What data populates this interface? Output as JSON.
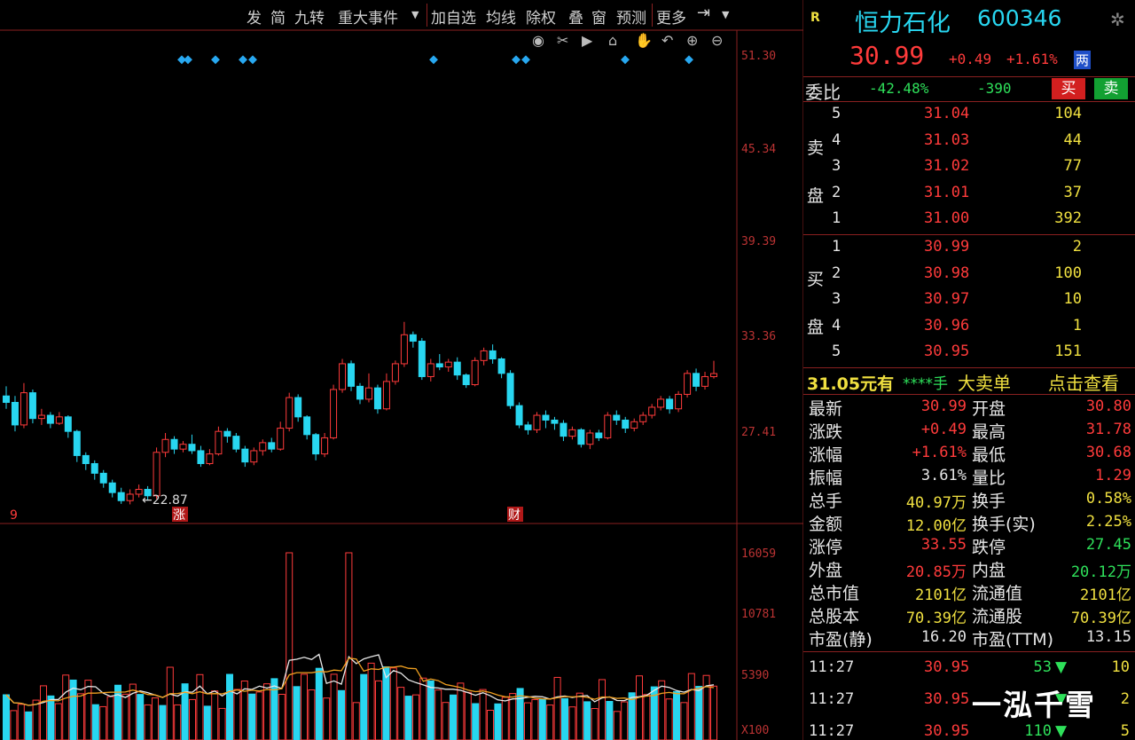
{
  "toolbar": {
    "items": [
      "发",
      "简",
      "九转",
      "重大事件",
      "加自选",
      "均线",
      "除权",
      "叠",
      "窗",
      "预测",
      "更多"
    ]
  },
  "chart_tools": [
    "eye-icon",
    "scissors-icon",
    "play-icon",
    "lock-icon",
    "hand-icon",
    "undo-icon",
    "zoom-in-icon",
    "zoom-out-icon"
  ],
  "chart_data": {
    "type": "candlestick",
    "price_axis_labels": [
      "51.30",
      "45.34",
      "39.39",
      "33.36",
      "27.41"
    ],
    "volume_axis_labels": [
      "16059",
      "10781",
      "5390",
      "X100"
    ],
    "min_marker": "22.87",
    "event_markers": [
      "9",
      "涨",
      "财"
    ],
    "candles": [
      [
        29.6,
        29.2,
        30.2,
        28.8
      ],
      [
        29.2,
        27.8,
        29.6,
        27.4
      ],
      [
        27.8,
        29.8,
        30.4,
        27.6
      ],
      [
        29.8,
        28.2,
        30.0,
        27.9
      ],
      [
        28.2,
        28.4,
        28.8,
        27.8
      ],
      [
        28.4,
        27.9,
        28.6,
        27.6
      ],
      [
        27.9,
        28.3,
        28.6,
        27.8
      ],
      [
        28.3,
        27.4,
        28.4,
        27.0
      ],
      [
        27.4,
        25.9,
        27.5,
        25.5
      ],
      [
        25.9,
        25.4,
        26.1,
        25.0
      ],
      [
        25.4,
        24.8,
        25.6,
        24.4
      ],
      [
        24.8,
        24.2,
        25.0,
        23.9
      ],
      [
        24.2,
        23.6,
        24.4,
        23.3
      ],
      [
        23.6,
        23.1,
        23.9,
        22.9
      ],
      [
        23.1,
        23.5,
        23.8,
        22.87
      ],
      [
        23.5,
        23.8,
        24.1,
        23.3
      ],
      [
        23.8,
        23.4,
        24.0,
        23.1
      ],
      [
        23.4,
        26.1,
        26.4,
        23.2
      ],
      [
        26.1,
        26.9,
        27.3,
        25.8
      ],
      [
        26.9,
        26.3,
        27.1,
        26.0
      ],
      [
        26.3,
        26.6,
        26.8,
        26.1
      ],
      [
        26.6,
        26.2,
        27.2,
        26.0
      ],
      [
        26.2,
        25.4,
        26.5,
        25.2
      ],
      [
        25.4,
        26.0,
        26.3,
        25.3
      ],
      [
        26.0,
        27.4,
        27.7,
        25.9
      ],
      [
        27.4,
        27.1,
        27.6,
        26.7
      ],
      [
        27.1,
        26.3,
        27.3,
        26.1
      ],
      [
        26.3,
        25.5,
        26.5,
        25.2
      ],
      [
        25.5,
        26.2,
        26.4,
        25.3
      ],
      [
        26.2,
        26.7,
        26.9,
        25.9
      ],
      [
        26.7,
        26.3,
        27.0,
        26.1
      ],
      [
        26.3,
        27.6,
        28.0,
        26.2
      ],
      [
        27.6,
        29.5,
        29.8,
        27.4
      ],
      [
        29.5,
        28.3,
        29.7,
        28.0
      ],
      [
        28.3,
        27.2,
        28.4,
        26.9
      ],
      [
        27.2,
        26.0,
        27.3,
        25.6
      ],
      [
        26.0,
        27.0,
        27.3,
        25.8
      ],
      [
        27.0,
        30.0,
        30.3,
        26.9
      ],
      [
        30.0,
        31.6,
        31.9,
        29.8
      ],
      [
        31.6,
        30.2,
        31.8,
        29.9
      ],
      [
        30.2,
        29.4,
        30.4,
        29.1
      ],
      [
        29.4,
        30.1,
        31.0,
        29.2
      ],
      [
        30.1,
        28.8,
        30.3,
        28.5
      ],
      [
        28.8,
        30.5,
        31.0,
        28.7
      ],
      [
        30.5,
        31.6,
        31.8,
        30.3
      ],
      [
        31.6,
        33.4,
        34.2,
        31.4
      ],
      [
        33.4,
        33.0,
        33.6,
        32.6
      ],
      [
        33.0,
        30.8,
        33.2,
        30.6
      ],
      [
        30.8,
        31.6,
        31.9,
        30.5
      ],
      [
        31.6,
        31.4,
        32.2,
        31.2
      ],
      [
        31.4,
        31.7,
        31.9,
        31.1
      ],
      [
        31.7,
        30.9,
        32.0,
        30.6
      ],
      [
        30.9,
        30.3,
        31.0,
        30.1
      ],
      [
        30.3,
        31.8,
        32.0,
        30.2
      ],
      [
        31.8,
        32.4,
        32.6,
        31.5
      ],
      [
        32.4,
        31.9,
        32.8,
        31.6
      ],
      [
        31.9,
        31.0,
        32.0,
        30.7
      ],
      [
        31.0,
        29.0,
        31.2,
        28.8
      ],
      [
        29.0,
        27.8,
        29.2,
        27.6
      ],
      [
        27.8,
        27.5,
        28.0,
        27.2
      ],
      [
        27.5,
        28.4,
        28.6,
        27.3
      ],
      [
        28.4,
        28.1,
        28.7,
        27.6
      ],
      [
        28.1,
        27.9,
        28.3,
        27.5
      ],
      [
        27.9,
        27.1,
        28.1,
        26.8
      ],
      [
        27.1,
        27.5,
        27.7,
        26.9
      ],
      [
        27.5,
        26.6,
        27.6,
        26.4
      ],
      [
        26.6,
        27.3,
        27.5,
        26.3
      ],
      [
        27.3,
        27.0,
        27.5,
        26.8
      ],
      [
        27.0,
        28.4,
        28.6,
        26.9
      ],
      [
        28.4,
        28.1,
        28.7,
        27.8
      ],
      [
        28.1,
        27.6,
        28.3,
        27.3
      ],
      [
        27.6,
        28.0,
        28.2,
        27.4
      ],
      [
        28.0,
        28.4,
        28.6,
        27.8
      ],
      [
        28.4,
        28.9,
        29.1,
        28.2
      ],
      [
        28.9,
        29.4,
        29.6,
        28.7
      ],
      [
        29.4,
        28.8,
        29.6,
        28.5
      ],
      [
        28.8,
        29.7,
        29.9,
        28.6
      ],
      [
        29.7,
        31.0,
        31.2,
        29.5
      ],
      [
        31.0,
        30.2,
        31.3,
        29.9
      ],
      [
        30.2,
        30.8,
        31.1,
        30.0
      ],
      [
        30.8,
        30.99,
        31.78,
        30.68
      ]
    ],
    "volumes": [
      3880,
      2520,
      3060,
      2410,
      3420,
      4650,
      3780,
      3120,
      5570,
      5140,
      3970,
      5130,
      3030,
      2860,
      3720,
      4700,
      3930,
      4790,
      3910,
      3010,
      3610,
      2960,
      6240,
      3010,
      4820,
      3470,
      5610,
      2900,
      4210,
      2710,
      5630,
      4340,
      5060,
      3940,
      4120,
      4820,
      5260,
      3920,
      16059,
      4580,
      5640,
      4300,
      6150,
      3600,
      5640,
      4240,
      16059,
      3210,
      5620,
      6590,
      5070,
      6280,
      6180,
      4520,
      3760,
      3870,
      5310,
      5070,
      4290,
      3220,
      3860,
      4880,
      4090,
      3120,
      4330,
      2550,
      3100,
      3660,
      3990,
      4420,
      3190,
      3470,
      3480,
      3000,
      5370,
      3550,
      2840,
      4020,
      3280,
      2700,
      5180,
      3310,
      2450,
      3270,
      4050,
      5500,
      3900,
      4560,
      5080,
      3520,
      4150,
      3210,
      5700,
      4600,
      5540,
      4620
    ]
  },
  "stock": {
    "flag": "R",
    "name": "恒力石化",
    "code": "600346",
    "price": "30.99",
    "change": "+0.49",
    "change_pct": "+1.61%",
    "badge": "两"
  },
  "ratio": {
    "label": "委比",
    "pct": "-42.48%",
    "diff": "-390",
    "buy_label": "买",
    "sell_label": "卖"
  },
  "orderbook": {
    "sell_label_a": "卖",
    "sell_label_b": "盘",
    "buy_label_a": "买",
    "buy_label_b": "盘",
    "sells": [
      {
        "level": "5",
        "price": "31.04",
        "vol": "104"
      },
      {
        "level": "4",
        "price": "31.03",
        "vol": "44"
      },
      {
        "level": "3",
        "price": "31.02",
        "vol": "77"
      },
      {
        "level": "2",
        "price": "31.01",
        "vol": "37"
      },
      {
        "level": "1",
        "price": "31.00",
        "vol": "392"
      }
    ],
    "buys": [
      {
        "level": "1",
        "price": "30.99",
        "vol": "2"
      },
      {
        "level": "2",
        "price": "30.98",
        "vol": "100"
      },
      {
        "level": "3",
        "price": "30.97",
        "vol": "10"
      },
      {
        "level": "4",
        "price": "30.96",
        "vol": "1"
      },
      {
        "level": "5",
        "price": "30.95",
        "vol": "151"
      }
    ]
  },
  "big_order": {
    "price": "31.05元有",
    "qty": "****手",
    "type": "大卖单",
    "link": "点击查看"
  },
  "quote": [
    {
      "l1": "最新",
      "v1": "30.99",
      "c1": "red",
      "l2": "开盘",
      "v2": "30.80",
      "c2": "red"
    },
    {
      "l1": "涨跌",
      "v1": "+0.49",
      "c1": "red",
      "l2": "最高",
      "v2": "31.78",
      "c2": "red"
    },
    {
      "l1": "涨幅",
      "v1": "+1.61%",
      "c1": "red",
      "l2": "最低",
      "v2": "30.68",
      "c2": "red"
    },
    {
      "l1": "振幅",
      "v1": "3.61%",
      "c1": "white",
      "l2": "量比",
      "v2": "1.29",
      "c2": "red"
    },
    {
      "l1": "总手",
      "v1": "40.97万",
      "c1": "yellow",
      "l2": "换手",
      "v2": "0.58%",
      "c2": "yellow"
    },
    {
      "l1": "金额",
      "v1": "12.00亿",
      "c1": "yellow",
      "l2": "换手(实)",
      "v2": "2.25%",
      "c2": "yellow"
    },
    {
      "l1": "涨停",
      "v1": "33.55",
      "c1": "red",
      "l2": "跌停",
      "v2": "27.45",
      "c2": "green"
    },
    {
      "l1": "外盘",
      "v1": "20.85万",
      "c1": "red",
      "l2": "内盘",
      "v2": "20.12万",
      "c2": "green"
    },
    {
      "l1": "总市值",
      "v1": "2101亿",
      "c1": "yellow",
      "l2": "流通值",
      "v2": "2101亿",
      "c2": "yellow"
    },
    {
      "l1": "总股本",
      "v1": "70.39亿",
      "c1": "yellow",
      "l2": "流通股",
      "v2": "70.39亿",
      "c2": "yellow"
    },
    {
      "l1": "市盈(静)",
      "v1": "16.20",
      "c1": "white",
      "l2": "市盈(TTM)",
      "v2": "13.15",
      "c2": "white"
    }
  ],
  "ticks": [
    {
      "time": "11:27",
      "price": "30.95",
      "vol": "53",
      "n": "10"
    },
    {
      "time": "11:27",
      "price": "30.95",
      "vol": "",
      "n": "2"
    },
    {
      "time": "11:27",
      "price": "30.95",
      "vol": "110",
      "n": "5"
    }
  ],
  "watermark": "一泓千雪",
  "colors": {
    "up": "#ff3b3b",
    "down": "#28d6f0",
    "grid": "#8a2020",
    "ma1": "#e8e8e8",
    "ma2": "#f0a020",
    "marker": "#28a8f0"
  }
}
